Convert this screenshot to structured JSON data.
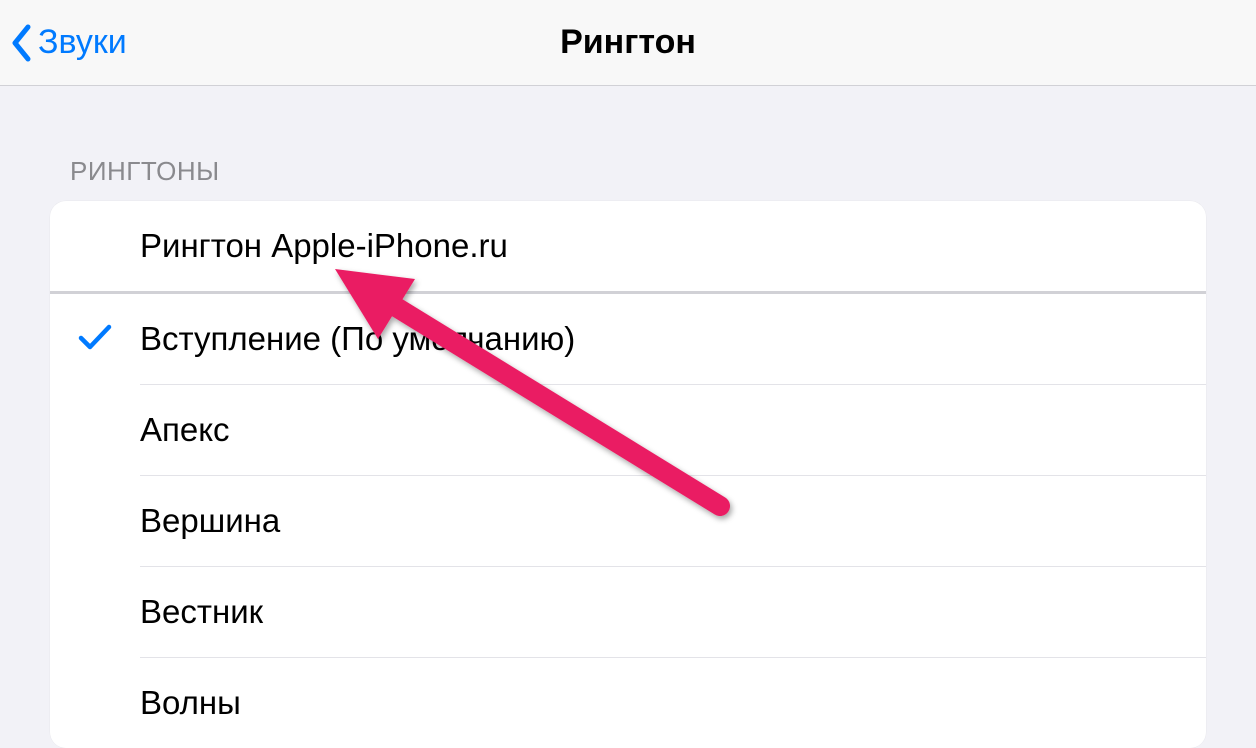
{
  "nav": {
    "back_label": "Звуки",
    "title": "Рингтон"
  },
  "section": {
    "header": "РИНГТОНЫ"
  },
  "ringtones": [
    {
      "label": "Рингтон Apple-iPhone.ru",
      "selected": false
    },
    {
      "label": "Вступление (По умолчанию)",
      "selected": true
    },
    {
      "label": "Апекс",
      "selected": false
    },
    {
      "label": "Вершина",
      "selected": false
    },
    {
      "label": "Вестник",
      "selected": false
    },
    {
      "label": "Волны",
      "selected": false
    }
  ],
  "colors": {
    "ios_blue": "#007aff",
    "arrow": "#ea1e63"
  }
}
